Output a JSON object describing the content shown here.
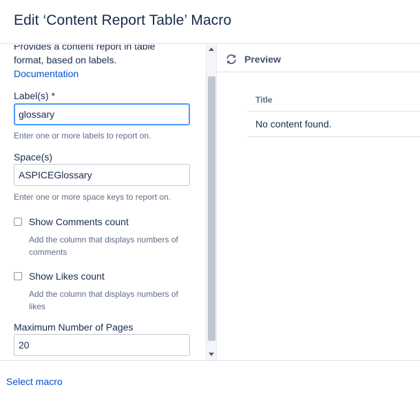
{
  "dialog": {
    "title": "Edit ‘Content Report Table’ Macro"
  },
  "macro_form": {
    "description": "Provides a content report in table format, based on labels.",
    "documentation_link": "Documentation",
    "labels": {
      "label": "Label(s) *",
      "value": "glossary",
      "hint": "Enter one or more labels to report on."
    },
    "spaces": {
      "label": "Space(s)",
      "value": "ASPICEGlossary",
      "hint": "Enter one or more space keys to report on."
    },
    "show_comments": {
      "label": "Show Comments count",
      "hint": "Add the column that displays numbers of comments",
      "checked": false
    },
    "show_likes": {
      "label": "Show Likes count",
      "hint": "Add the column that displays numbers of likes",
      "checked": false
    },
    "max_pages": {
      "label": "Maximum Number of Pages",
      "value": "20"
    }
  },
  "preview": {
    "label": "Preview",
    "icon": "refresh-icon",
    "table": {
      "columns": [
        "Title"
      ],
      "empty_message": "No content found."
    }
  },
  "footer": {
    "select_macro_link": "Select macro"
  },
  "colors": {
    "link": "#0052cc",
    "focus": "#4c9aff",
    "text": "#172b4d",
    "muted": "#5e6c84"
  }
}
